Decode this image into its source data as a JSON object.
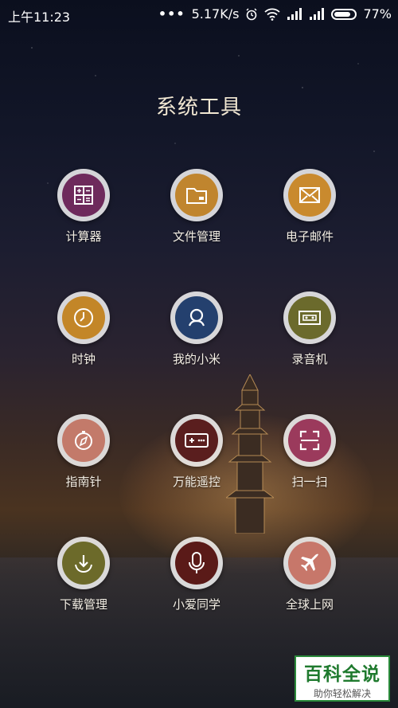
{
  "status_bar": {
    "time": "上午11:23",
    "dots": "•••",
    "speed": "5.17K/s",
    "battery_percent": "77%",
    "icons": [
      "alarm-icon",
      "wifi-icon",
      "signal-icon",
      "signal-icon",
      "battery-icon"
    ]
  },
  "folder": {
    "title": "系统工具",
    "apps": [
      {
        "label": "计算器",
        "icon": "calculator-icon",
        "color": "#6e2a5c"
      },
      {
        "label": "文件管理",
        "icon": "folder-icon",
        "color": "#c0852e"
      },
      {
        "label": "电子邮件",
        "icon": "mail-icon",
        "color": "#c98a2e"
      },
      {
        "label": "时钟",
        "icon": "clock-icon",
        "color": "#c38628"
      },
      {
        "label": "我的小米",
        "icon": "mi-person-icon",
        "color": "#24406e"
      },
      {
        "label": "录音机",
        "icon": "cassette-icon",
        "color": "#6b6a2c"
      },
      {
        "label": "指南针",
        "icon": "compass-icon",
        "color": "#c37a6a"
      },
      {
        "label": "万能遥控",
        "icon": "gamepad-icon",
        "color": "#5a1e1e"
      },
      {
        "label": "扫一扫",
        "icon": "scan-icon",
        "color": "#9b3a5c"
      },
      {
        "label": "下载管理",
        "icon": "download-icon",
        "color": "#6c6a2a"
      },
      {
        "label": "小爱同学",
        "icon": "microphone-icon",
        "color": "#5a1a18"
      },
      {
        "label": "全球上网",
        "icon": "airplane-icon",
        "color": "#c7776a"
      }
    ]
  },
  "watermark": {
    "title": "百科全说",
    "subtitle": "助你轻松解决"
  }
}
